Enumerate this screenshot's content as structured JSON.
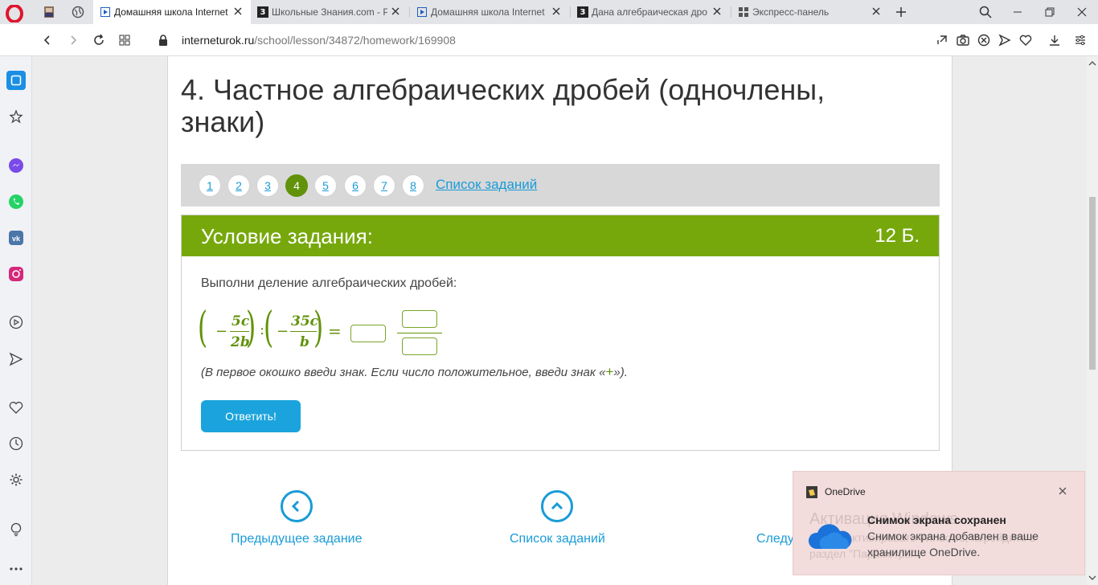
{
  "browser": {
    "tabs": [
      {
        "title": "Домашняя школа Internet",
        "active": true
      },
      {
        "title": "Школьные Знания.com - P",
        "active": false
      },
      {
        "title": "Домашняя школа Internet",
        "active": false
      },
      {
        "title": "Дана алгебраическая дро",
        "active": false
      },
      {
        "title": "Экспресс-панель",
        "active": false
      }
    ],
    "url_domain": "interneturok.ru",
    "url_path": "/school/lesson/34872/homework/169908"
  },
  "page": {
    "heading": "4. Частное алгебраических дробей (одночлены, знаки)",
    "pager": {
      "pages": [
        "1",
        "2",
        "3",
        "4",
        "5",
        "6",
        "7",
        "8"
      ],
      "active_page": "4",
      "task_list_link": "Список заданий"
    },
    "task": {
      "title": "Условие задания:",
      "points": "12 Б.",
      "instruction": "Выполни деление алгебраических дробей:",
      "formula": {
        "frac1_num": "5c",
        "frac1_den": "2b",
        "frac2_num": "35c",
        "frac2_den": "b",
        "minus": "−",
        "divide": ":",
        "equals": "="
      },
      "hint_before": "(В первое окошко введи знак. Если число положительное, введи знак «",
      "hint_plus": "+",
      "hint_after": "»).",
      "answer_button": "Ответить!"
    },
    "bottom_nav": {
      "prev": "Предыдущее задание",
      "list": "Список заданий",
      "next": "Следу"
    }
  },
  "toast": {
    "app_name": "OneDrive",
    "title": "Снимок экрана сохранен",
    "body": "Снимок экрана добавлен в ваше хранилище OneDrive.",
    "watermark": "Активация Windows",
    "watermark_sub": "Чтобы активировать Windows, перейдите в раздел \"Параметры\"."
  },
  "colors": {
    "accent_green": "#76a80c",
    "link_blue": "#1a9bd7",
    "button_blue": "#1aa3dc"
  }
}
